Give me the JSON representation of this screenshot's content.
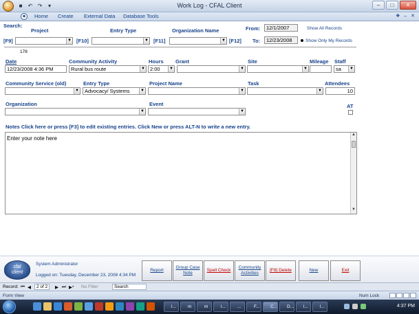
{
  "window": {
    "title": "Work Log - CFAL Client"
  },
  "ribbon": {
    "tabs": [
      "Home",
      "Create",
      "External Data",
      "Database Tools"
    ],
    "help_glyphs": "❖ – ✕"
  },
  "search": {
    "label": "Search:",
    "project_label": "Project",
    "entry_type_label": "Entry Type",
    "organization_label": "Organization Name",
    "f9": "[F9]",
    "f10": "[F10]",
    "f11": "[F11]",
    "f12": "[F12]",
    "from_label": "From:",
    "from_value": "12/1/2007",
    "to_label": "To:",
    "to_value": "12/23/2008",
    "show_all": "Show All Records",
    "show_mine": "Show Only My Records",
    "record_id": "178"
  },
  "entry": {
    "date_label": "Date",
    "date_value": "12/23/2008 4:36 PM",
    "activity_label": "Community Activity",
    "activity_value": "Rural bus route",
    "hours_label": "Hours",
    "hours_value": "2:00",
    "grant_label": "Grant",
    "site_label": "Site",
    "mileage_label": "Mileage",
    "staff_label": "Staff",
    "staff_value": "sa",
    "service_label": "Community Service (old)",
    "entry_type_label": "Entry Type",
    "entry_type_value": "Advocacy/ Systems",
    "project_label": "Project Name",
    "task_label": "Task",
    "attendees_label": "Attendees",
    "attendees_value": "10",
    "org_label": "Organization",
    "event_label": "Event",
    "at_label": "AT"
  },
  "notes": {
    "header": "Notes  Click here or press [F3] to edit existing entries. Click New or press ALT-N to write a new entry.",
    "body": "Enter your note here"
  },
  "footer": {
    "logo_line1": "cfal",
    "logo_line2": "client",
    "user": "System Administrator",
    "logged_on": "Logged on: Tuesday, December 23, 2008 4:34 PM",
    "buttons": {
      "report": "Report",
      "group_case_note": "Group Case Note",
      "spell_check": "Spell Check",
      "community_activities": "Community Activities",
      "delete": "[F8] Delete",
      "new": "New",
      "exit": "Exit"
    }
  },
  "record_nav": {
    "label": "Record:",
    "first": "⏮",
    "prev": "◀",
    "position": "2 of 2",
    "next": "▶",
    "last": "⏭",
    "new": "▶*",
    "filter": "No Filter",
    "search": "Search"
  },
  "status": {
    "view": "Form View",
    "numlock": "Num Lock"
  },
  "taskbar": {
    "tasks": [
      "l...",
      "m",
      "m",
      "l...",
      "...",
      "F...",
      "C...",
      "D...",
      "l...",
      "l..."
    ],
    "clock": "4:37 PM"
  },
  "colors": {
    "label_blue": "#15428b",
    "delete_red": "#c00000"
  }
}
